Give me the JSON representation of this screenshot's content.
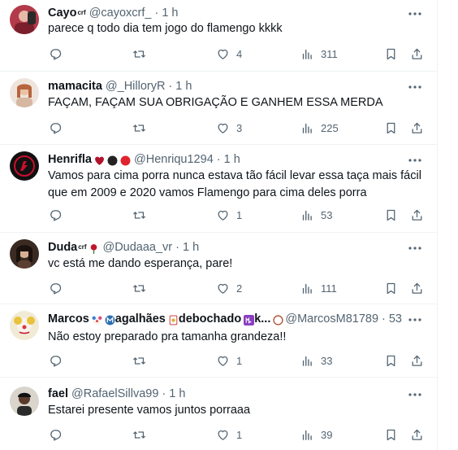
{
  "tweets": [
    {
      "name": "Cayo",
      "name_sup": "crf",
      "handle": "@cayoxcrf_",
      "time": "1 h",
      "text": "parece q todo dia tem jogo do flamengo kkkk",
      "likes": "4",
      "views": "311"
    },
    {
      "name": "mamacita",
      "name_sup": "",
      "handle": "@_HilloryR",
      "time": "1 h",
      "text": "FAÇAM, FAÇAM SUA OBRIGAÇÃO E GANHEM ESSA MERDA",
      "likes": "3",
      "views": "225"
    },
    {
      "name": "Henrifla",
      "name_sup": "",
      "handle": "@Henriqu1294",
      "time": "1 h",
      "text": "Vamos para cima porra nunca estava tão fácil levar essa taça mais fácil que em 2009 e 2020 vamos Flamengo para cima deles porra",
      "likes": "1",
      "views": "53"
    },
    {
      "name": "Duda",
      "name_sup": "crf",
      "handle": "@Dudaaa_vr",
      "time": "1 h",
      "text": "vc está me dando esperança, pare!",
      "likes": "2",
      "views": "111"
    },
    {
      "name": "Marcos",
      "name_mid": "agalhães",
      "name_tail": "debochado",
      "name_end": "k...",
      "handle": "@MarcosM81789",
      "time": "53 min",
      "text": "Não estoy preparado pra tamanha grandeza!!",
      "likes": "1",
      "views": "33"
    },
    {
      "name": "fael",
      "name_sup": "",
      "handle": "@RafaelSillva99",
      "time": "1 h",
      "text": "Estarei presente vamos juntos porraaa",
      "likes": "1",
      "views": "39"
    }
  ],
  "separator": "·",
  "icons": {
    "more": "more-horizontal-icon",
    "reply": "reply-icon",
    "retweet": "retweet-icon",
    "like": "heart-icon",
    "views": "views-icon",
    "bookmark": "bookmark-icon",
    "share": "share-icon"
  },
  "colors": {
    "text": "#0f1419",
    "muted": "#536471",
    "divider": "#eff3f4"
  }
}
